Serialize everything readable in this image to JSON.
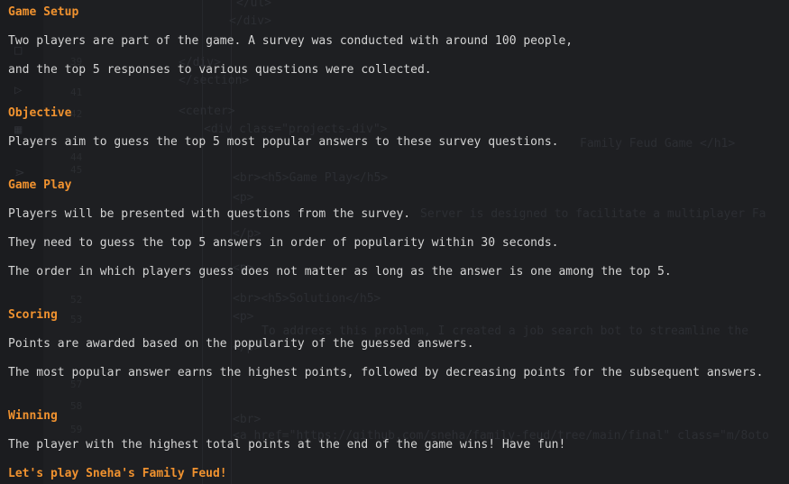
{
  "game_info": {
    "setup": {
      "heading": "Game Setup",
      "lines": [
        "Two players are part of the game. A survey was conducted with around 100 people,",
        "and the top 5 responses to various questions were collected."
      ]
    },
    "objective": {
      "heading": "Objective",
      "lines": [
        "Players aim to guess the top 5 most popular answers to these survey questions."
      ]
    },
    "game_play": {
      "heading": "Game Play",
      "lines": [
        "Players will be presented with questions from the survey.",
        "They need to guess the top 5 answers in order of popularity within 30 seconds.",
        "The order in which players guess does not matter as long as the answer is one among the top 5."
      ]
    },
    "scoring": {
      "heading": "Scoring",
      "lines": [
        "Points are awarded based on the popularity of the guessed answers.",
        "The most popular answer earns the highest points, followed by decreasing points for the subsequent answers."
      ]
    },
    "winning": {
      "heading": "Winning",
      "lines": [
        "The player with the highest total points at the end of the game wins! Have fun!"
      ]
    },
    "closing": {
      "heading": "Let's play Sneha's Family Feud!"
    }
  },
  "colors": {
    "background": "#1e1f22",
    "heading": "#f0922f",
    "text": "#d4d4d4"
  }
}
